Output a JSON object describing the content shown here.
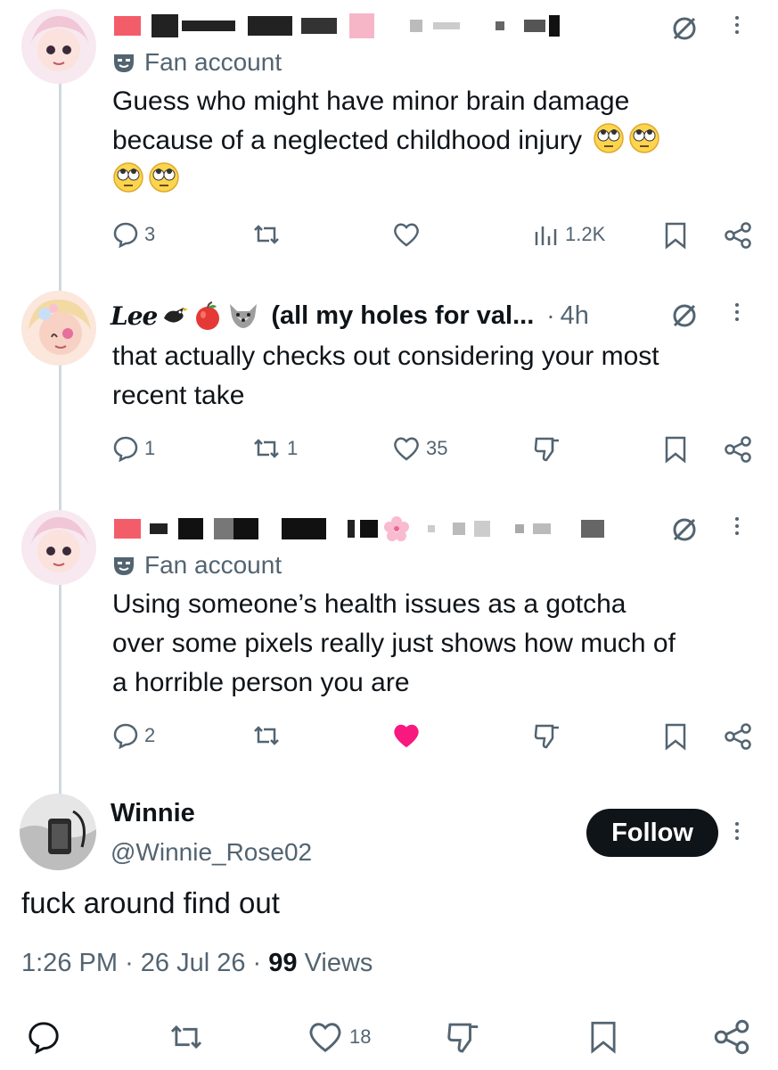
{
  "posts": [
    {
      "badge": "Fan account",
      "text_line1": "Guess who might have minor brain damage",
      "text_line2": "because of a neglected childhood injury",
      "emoji_name": "face-with-rolling-eyes",
      "replies": "3",
      "views": "1.2K"
    },
    {
      "display_name": "(all my holes for val...",
      "name_script": "Lee",
      "time": "4h",
      "text_line1": "that actually checks out considering your most",
      "text_line2": "recent take",
      "replies": "1",
      "reposts": "1",
      "likes": "35"
    },
    {
      "badge": "Fan account",
      "text_line1": "Using someone’s health issues as a gotcha",
      "text_line2": "over some pixels really just shows how much of",
      "text_line3": "a horrible person you are",
      "replies": "2",
      "liked": true
    }
  ],
  "main_post": {
    "display_name": "Winnie",
    "handle": "@Winnie_Rose02",
    "follow_label": "Follow",
    "text": "fuck around find out",
    "time": "1:26 PM",
    "date": "26 Jul 26",
    "views_count": "99",
    "views_label": "Views",
    "likes": "18"
  },
  "colors": {
    "text": "#0f1419",
    "muted": "#536471",
    "thread_line": "#cfd9de",
    "liked_heart": "#f91880"
  }
}
